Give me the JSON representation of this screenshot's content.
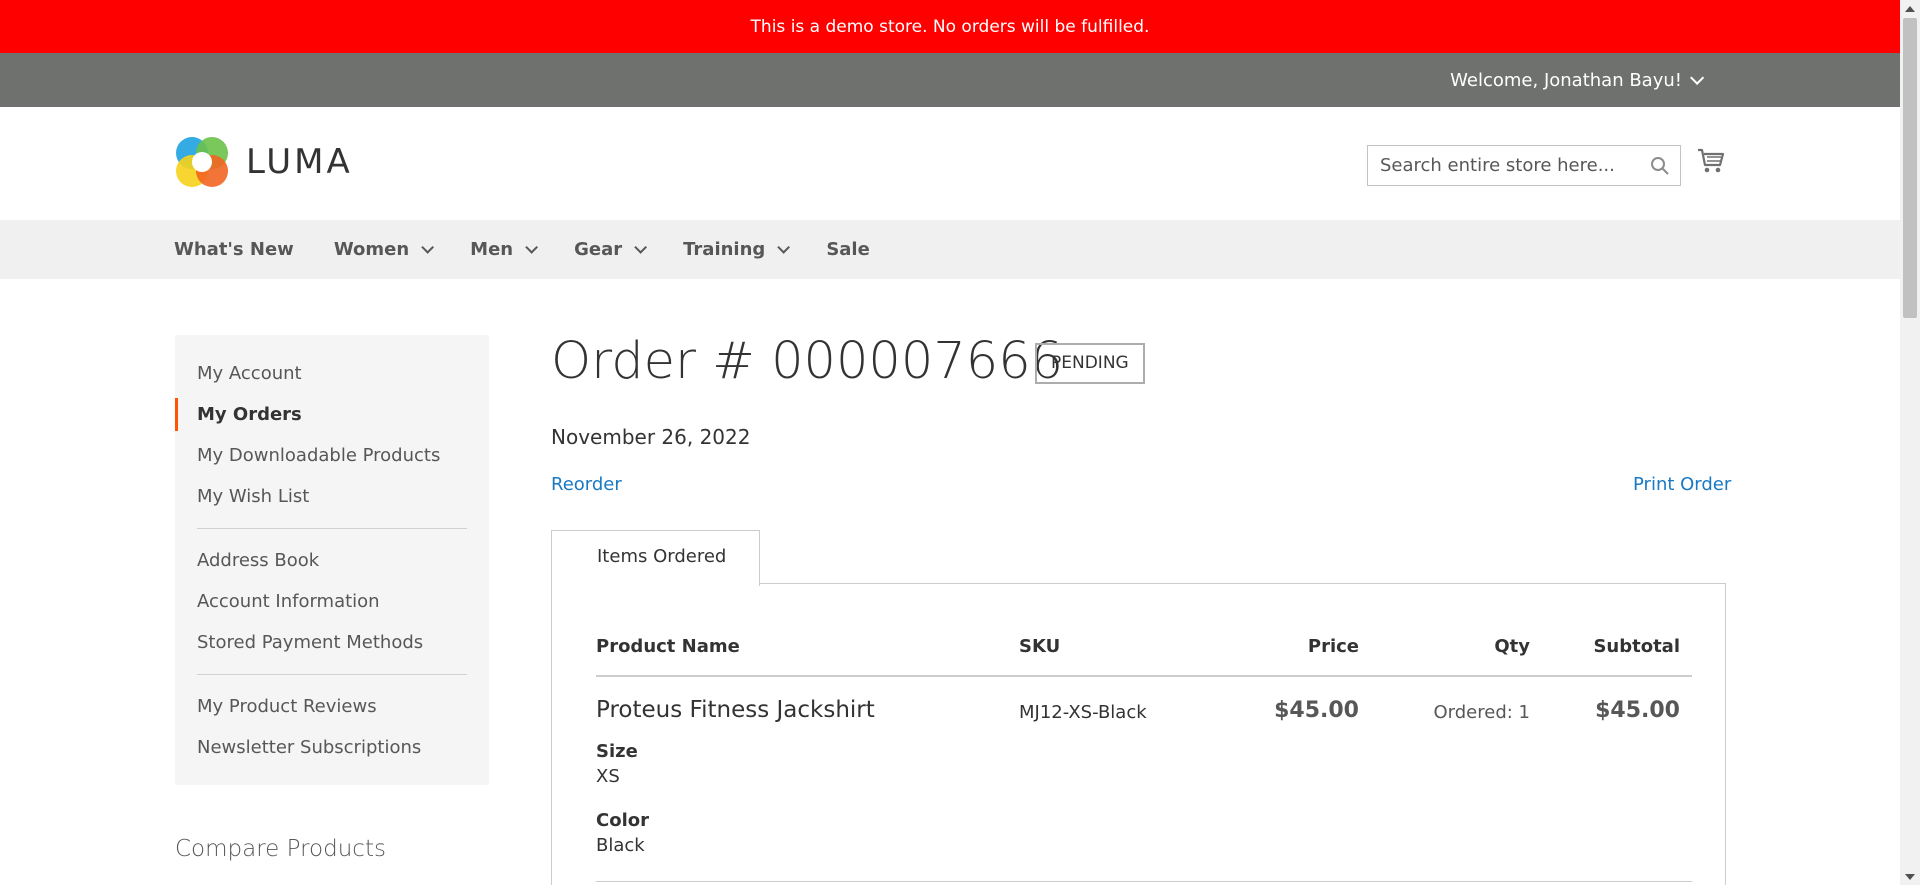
{
  "demo_notice": "This is a demo store. No orders will be fulfilled.",
  "header": {
    "welcome": "Welcome, Jonathan Bayu!",
    "logo_text": "LUMA",
    "search_placeholder": "Search entire store here..."
  },
  "nav": {
    "items": [
      {
        "label": "What's New",
        "has_dropdown": false
      },
      {
        "label": "Women",
        "has_dropdown": true
      },
      {
        "label": "Men",
        "has_dropdown": true
      },
      {
        "label": "Gear",
        "has_dropdown": true
      },
      {
        "label": "Training",
        "has_dropdown": true
      },
      {
        "label": "Sale",
        "has_dropdown": false
      }
    ]
  },
  "sidebar": {
    "items": [
      "My Account",
      "My Orders",
      "My Downloadable Products",
      "My Wish List",
      "Address Book",
      "Account Information",
      "Stored Payment Methods",
      "My Product Reviews",
      "Newsletter Subscriptions"
    ],
    "active": "My Orders",
    "compare_title": "Compare Products"
  },
  "order": {
    "title": "Order # 000007666",
    "status": "PENDING",
    "date": "November 26, 2022",
    "reorder_label": "Reorder",
    "print_label": "Print Order",
    "tab_label": "Items Ordered",
    "columns": [
      "Product Name",
      "SKU",
      "Price",
      "Qty",
      "Subtotal"
    ],
    "items": [
      {
        "name": "Proteus Fitness Jackshirt",
        "options": [
          {
            "label": "Size",
            "value": "XS"
          },
          {
            "label": "Color",
            "value": "Black"
          }
        ],
        "sku": "MJ12-XS-Black",
        "price": "$45.00",
        "qty": "Ordered: 1",
        "subtotal": "$45.00"
      }
    ]
  },
  "colors": {
    "demo_bar": "#ff0000",
    "header_panel": "#6e716e",
    "link": "#1979c3",
    "active_marker": "#ff5501"
  }
}
